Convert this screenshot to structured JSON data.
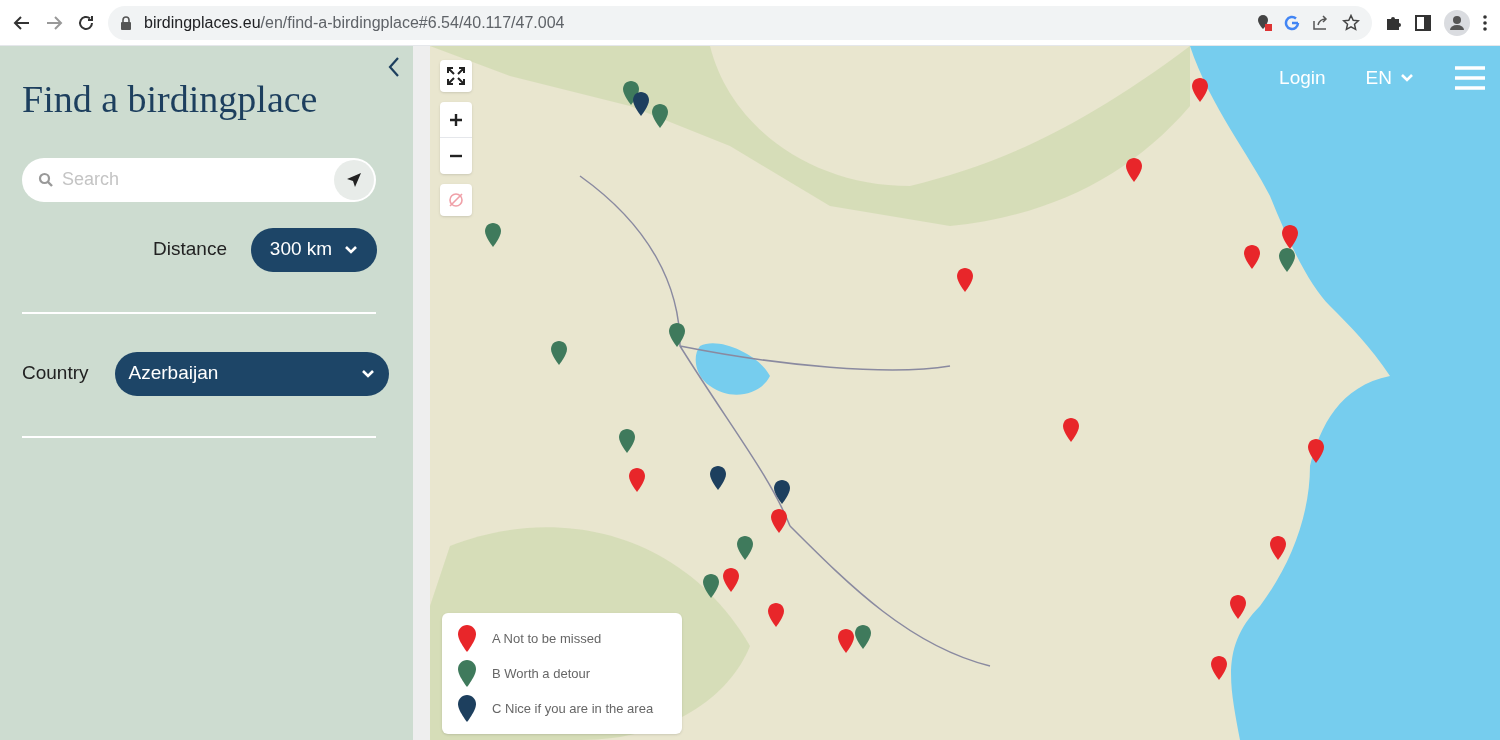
{
  "browser": {
    "url_host": "birdingplaces.eu",
    "url_path": "/en/find-a-birdingplace#6.54/40.117/47.004"
  },
  "sidebar": {
    "title": "Find a birdingplace",
    "search": {
      "placeholder": "Search"
    },
    "distance": {
      "label": "Distance",
      "value": "300 km"
    },
    "country": {
      "label": "Country",
      "value": "Azerbaijan"
    }
  },
  "header": {
    "login": "Login",
    "language": "EN"
  },
  "legend": [
    {
      "label": "A Not to be missed",
      "color": "#e8262a"
    },
    {
      "label": "B Worth a detour",
      "color": "#3f7a5c"
    },
    {
      "label": "C Nice if you are in the area",
      "color": "#1d3f5e"
    }
  ],
  "pins": [
    {
      "color": "#e8262a"
    },
    {
      "color": "#e8262a"
    },
    {
      "color": "#e8262a"
    },
    {
      "color": "#e8262a"
    },
    {
      "color": "#e8262a"
    },
    {
      "color": "#e8262a"
    },
    {
      "color": "#e8262a"
    },
    {
      "color": "#e8262a"
    },
    {
      "color": "#e8262a"
    },
    {
      "color": "#e8262a"
    },
    {
      "color": "#e8262a"
    },
    {
      "color": "#e8262a"
    },
    {
      "color": "#e8262a"
    },
    {
      "color": "#e8262a"
    },
    {
      "color": "#e8262a"
    },
    {
      "color": "#3f7a5c"
    },
    {
      "color": "#3f7a5c"
    },
    {
      "color": "#3f7a5c"
    },
    {
      "color": "#3f7a5c"
    },
    {
      "color": "#3f7a5c"
    },
    {
      "color": "#3f7a5c"
    },
    {
      "color": "#3f7a5c"
    },
    {
      "color": "#3f7a5c"
    },
    {
      "color": "#3f7a5c"
    },
    {
      "color": "#3f7a5c"
    },
    {
      "color": "#1d3f5e"
    },
    {
      "color": "#1d3f5e"
    },
    {
      "color": "#1d3f5e"
    }
  ]
}
